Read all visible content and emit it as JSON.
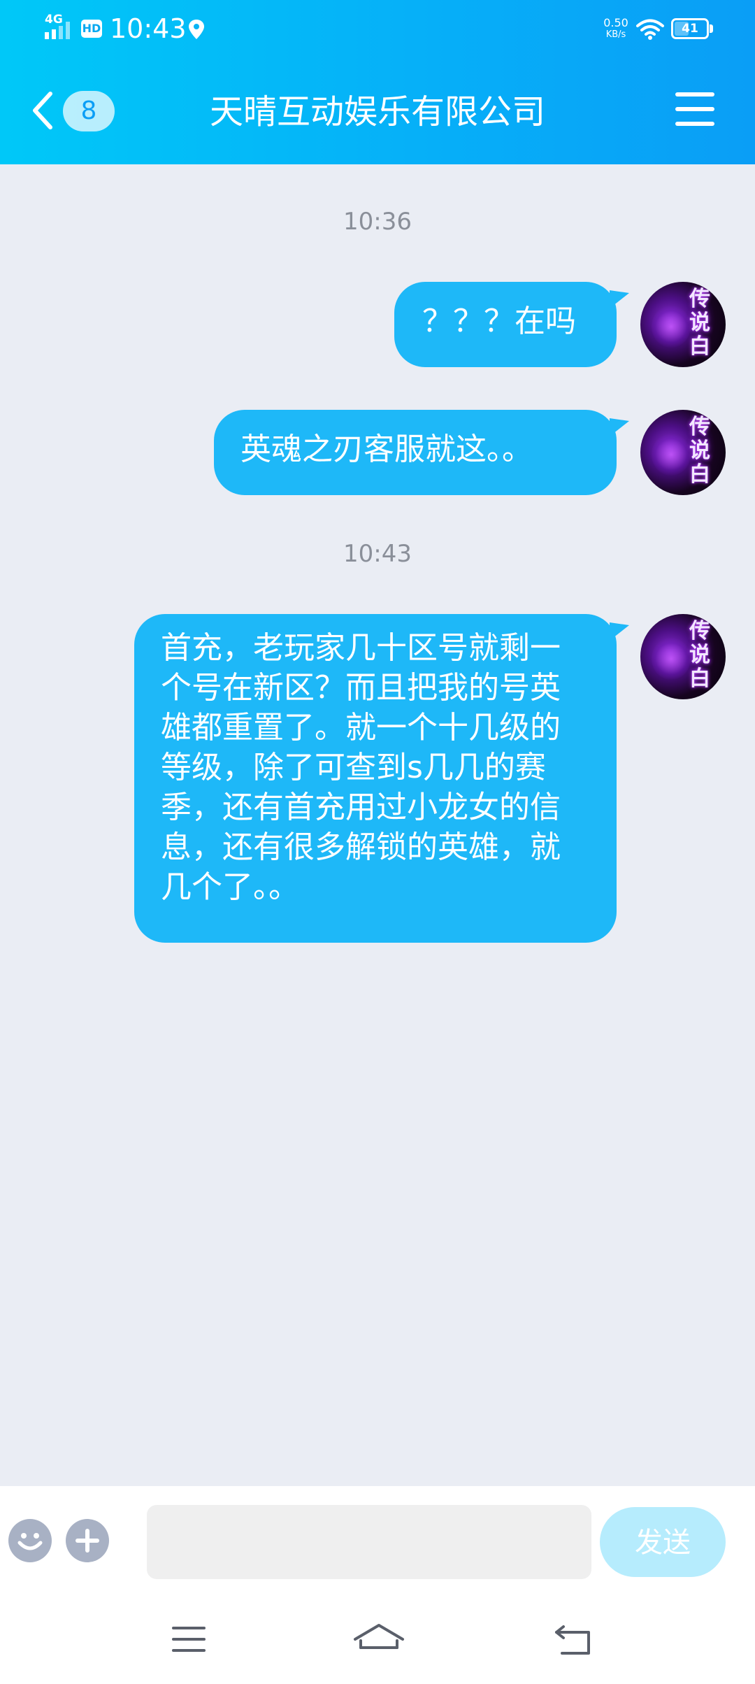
{
  "status_bar": {
    "network": "4G",
    "hd": "HD",
    "time": "10:43",
    "speed_value": "0.50",
    "speed_unit": "KB/s",
    "battery": "41"
  },
  "header": {
    "badge": "8",
    "title": "天晴互动娱乐有限公司"
  },
  "messages": {
    "ts1": "10:36",
    "m1": "？？？在吗",
    "m2": "英魂之刃客服就这。。",
    "ts2": "10:43",
    "m3": "首充，老玩家几十区号就剩一个号在新区？而且把我的号英雄都重置了。就一个十几级的等级，除了可查到s几几的赛季，还有首充用过小龙女的信息，还有很多解锁的英雄，就几个了。。"
  },
  "avatar_text": "传说白",
  "input": {
    "value": "",
    "send_label": "发送"
  },
  "colors": {
    "header_start": "#00c8f8",
    "header_end": "#0a9ef6",
    "bubble": "#1eb8f8",
    "chat_bg": "#eaedf4",
    "send_disabled": "#b6ecfd"
  },
  "icons": {
    "back": "chevron-left-icon",
    "menu": "hamburger-icon",
    "emoji": "smiley-icon",
    "plus": "plus-icon",
    "nav_menu": "menu-lines-icon",
    "nav_home": "home-icon",
    "nav_back": "back-arrow-icon"
  }
}
